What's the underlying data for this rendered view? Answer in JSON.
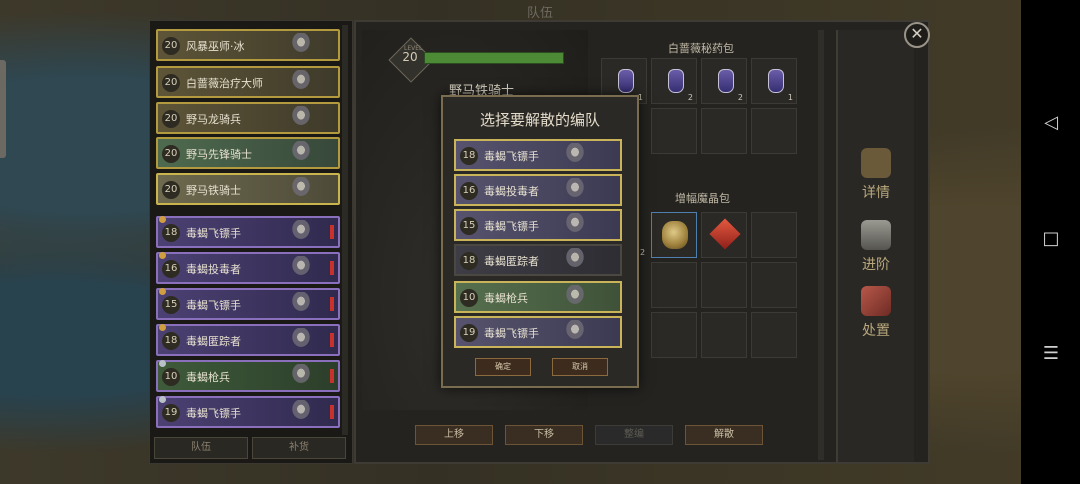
{
  "screen_title": "队伍",
  "roster": {
    "items": [
      {
        "level": "20",
        "name": "风暴巫师·冰",
        "style": "gold"
      },
      {
        "level": "20",
        "name": "白蔷薇治疗大师",
        "style": "gold"
      },
      {
        "level": "20",
        "name": "野马龙骑兵",
        "style": "gold"
      },
      {
        "level": "20",
        "name": "野马先锋骑士",
        "style": "green"
      },
      {
        "level": "20",
        "name": "野马铁骑士",
        "style": "sel"
      },
      {
        "level": "18",
        "name": "毒蝎飞镖手",
        "style": "purple"
      },
      {
        "level": "16",
        "name": "毒蝎投毒者",
        "style": "purple"
      },
      {
        "level": "15",
        "name": "毒蝎飞镖手",
        "style": "purple"
      },
      {
        "level": "18",
        "name": "毒蝎匿踪者",
        "style": "purple"
      },
      {
        "level": "10",
        "name": "毒蝎枪兵",
        "style": "green2"
      },
      {
        "level": "19",
        "name": "毒蝎飞镖手",
        "style": "purple"
      }
    ],
    "tabs": [
      "队伍",
      "补货"
    ]
  },
  "unit": {
    "level": "20",
    "level_tag": "LEVEL",
    "name": "野马铁骑士",
    "hp_fraction": 1.0
  },
  "inventory": {
    "potions_title": "白蔷薇秘药包",
    "potion_counts": [
      "1",
      "2",
      "2",
      "1"
    ],
    "crystals_title": "增幅魔晶包",
    "crystal_count": "2"
  },
  "side_menu": [
    "详情",
    "进阶",
    "处置"
  ],
  "bottom_buttons": [
    "上移",
    "下移",
    "整编",
    "解散"
  ],
  "modal": {
    "title": "选择要解散的编队",
    "items": [
      {
        "level": "18",
        "name": "毒蝎飞镖手",
        "style": "purple"
      },
      {
        "level": "16",
        "name": "毒蝎投毒者",
        "style": "purple"
      },
      {
        "level": "15",
        "name": "毒蝎飞镖手",
        "style": "purple"
      },
      {
        "level": "18",
        "name": "毒蝎匿踪者",
        "style": "dark"
      },
      {
        "level": "10",
        "name": "毒蝎枪兵",
        "style": "green"
      },
      {
        "level": "19",
        "name": "毒蝎飞镖手",
        "style": "purple"
      }
    ],
    "confirm_label": "确定",
    "cancel_label": "取消"
  },
  "colors": {
    "gold_border": "#b39a3f",
    "purple_fill": "#4c4173",
    "hp_green": "#4c8a35"
  },
  "nav": {
    "back_icon": "triangle-back-icon",
    "home_icon": "square-home-icon",
    "menu_icon": "menu-lines-icon"
  }
}
